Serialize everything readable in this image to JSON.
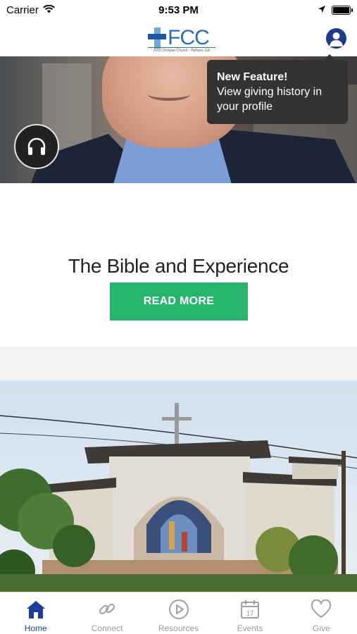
{
  "status_bar": {
    "carrier": "Carrier",
    "time": "9:53 PM"
  },
  "header": {
    "logo_text": "FCC",
    "logo_subtitle": "First Christian Church · Pelham, GA",
    "colors": {
      "brand_blue": "#2a6bbd",
      "profile_blue": "#1e3a8a"
    }
  },
  "tooltip": {
    "title": "New Feature!",
    "body": "View giving history in your profile"
  },
  "hero": {
    "title": "The Bible and Experience",
    "read_more_label": "READ MORE",
    "accent_color": "#27b56e",
    "audio_icon": "headphones-icon"
  },
  "tabs": [
    {
      "label": "Home",
      "icon": "home-icon",
      "active": true
    },
    {
      "label": "Connect",
      "icon": "link-icon",
      "active": false
    },
    {
      "label": "Resources",
      "icon": "play-circle-icon",
      "active": false
    },
    {
      "label": "Events",
      "icon": "calendar-icon",
      "active": false
    },
    {
      "label": "Give",
      "icon": "heart-icon",
      "active": false
    }
  ]
}
